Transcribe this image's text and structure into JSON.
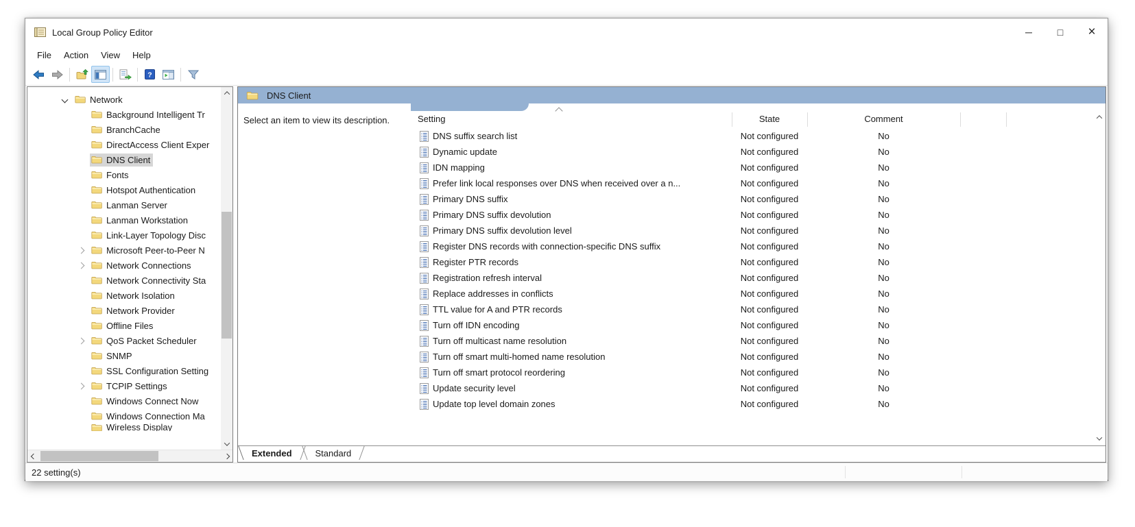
{
  "colors": {
    "banner": "#95b1d2",
    "selection": "#d6d6d6",
    "toolbar_active": "#cfe4f7"
  },
  "window": {
    "title": "Local Group Policy Editor",
    "controls": {
      "minimize": "─",
      "maximize": "□",
      "close": "×"
    }
  },
  "menu": {
    "items": [
      {
        "label": "File"
      },
      {
        "label": "Action"
      },
      {
        "label": "View"
      },
      {
        "label": "Help"
      }
    ]
  },
  "toolbar": {
    "icons": [
      "back",
      "forward",
      "up-one-level",
      "show-console-tree",
      "export-list",
      "help",
      "show-action-pane",
      "filter"
    ]
  },
  "tree": {
    "root": {
      "label": "Network"
    },
    "children": [
      {
        "label": "Background Intelligent Tr"
      },
      {
        "label": "BranchCache"
      },
      {
        "label": "DirectAccess Client Exper"
      },
      {
        "label": "DNS Client",
        "selected": true
      },
      {
        "label": "Fonts"
      },
      {
        "label": "Hotspot Authentication"
      },
      {
        "label": "Lanman Server"
      },
      {
        "label": "Lanman Workstation"
      },
      {
        "label": "Link-Layer Topology Disc"
      },
      {
        "label": "Microsoft Peer-to-Peer N",
        "expandable": true
      },
      {
        "label": "Network Connections",
        "expandable": true
      },
      {
        "label": "Network Connectivity Sta"
      },
      {
        "label": "Network Isolation"
      },
      {
        "label": "Network Provider"
      },
      {
        "label": "Offline Files"
      },
      {
        "label": "QoS Packet Scheduler",
        "expandable": true
      },
      {
        "label": "SNMP"
      },
      {
        "label": "SSL Configuration Setting"
      },
      {
        "label": "TCPIP Settings",
        "expandable": true
      },
      {
        "label": "Windows Connect Now"
      },
      {
        "label": "Windows Connection Ma"
      },
      {
        "label": "Wireless Display",
        "clipped": true
      }
    ]
  },
  "content": {
    "folder_title": "DNS Client",
    "description_placeholder": "Select an item to view its description.",
    "columns": {
      "setting": "Setting",
      "state": "State",
      "comment": "Comment"
    },
    "rows": [
      {
        "setting": "DNS suffix search list",
        "state": "Not configured",
        "comment": "No"
      },
      {
        "setting": "Dynamic update",
        "state": "Not configured",
        "comment": "No"
      },
      {
        "setting": "IDN mapping",
        "state": "Not configured",
        "comment": "No"
      },
      {
        "setting": "Prefer link local responses over DNS when received over a n...",
        "state": "Not configured",
        "comment": "No"
      },
      {
        "setting": "Primary DNS suffix",
        "state": "Not configured",
        "comment": "No"
      },
      {
        "setting": "Primary DNS suffix devolution",
        "state": "Not configured",
        "comment": "No"
      },
      {
        "setting": "Primary DNS suffix devolution level",
        "state": "Not configured",
        "comment": "No"
      },
      {
        "setting": "Register DNS records with connection-specific DNS suffix",
        "state": "Not configured",
        "comment": "No"
      },
      {
        "setting": "Register PTR records",
        "state": "Not configured",
        "comment": "No"
      },
      {
        "setting": "Registration refresh interval",
        "state": "Not configured",
        "comment": "No"
      },
      {
        "setting": "Replace addresses in conflicts",
        "state": "Not configured",
        "comment": "No"
      },
      {
        "setting": "TTL value for A and PTR records",
        "state": "Not configured",
        "comment": "No"
      },
      {
        "setting": "Turn off IDN encoding",
        "state": "Not configured",
        "comment": "No"
      },
      {
        "setting": "Turn off multicast name resolution",
        "state": "Not configured",
        "comment": "No"
      },
      {
        "setting": "Turn off smart multi-homed name resolution",
        "state": "Not configured",
        "comment": "No"
      },
      {
        "setting": "Turn off smart protocol reordering",
        "state": "Not configured",
        "comment": "No"
      },
      {
        "setting": "Update security level",
        "state": "Not configured",
        "comment": "No"
      },
      {
        "setting": "Update top level domain zones",
        "state": "Not configured",
        "comment": "No"
      }
    ],
    "tabs": [
      {
        "label": "Extended",
        "active": true
      },
      {
        "label": "Standard"
      }
    ]
  },
  "statusbar": {
    "text": "22 setting(s)"
  }
}
